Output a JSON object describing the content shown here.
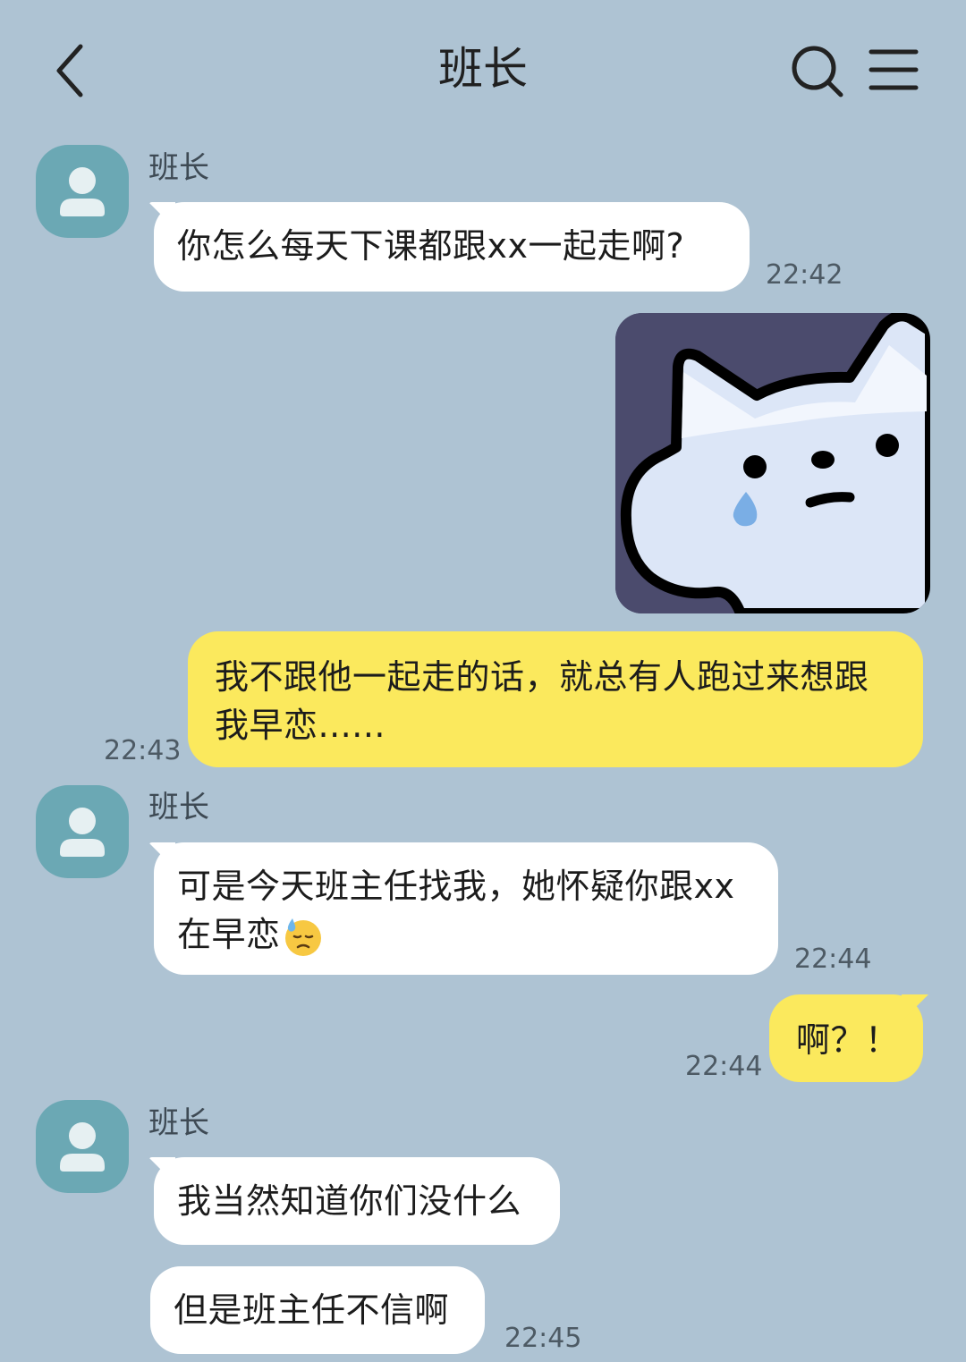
{
  "header": {
    "title": "班长",
    "back_icon": "chevron-left-icon",
    "search_icon": "search-icon",
    "menu_icon": "hamburger-menu-icon"
  },
  "colors": {
    "background": "#aec3d3",
    "incoming_bubble": "#ffffff",
    "outgoing_bubble": "#fbe95d",
    "avatar": "#6ba8b4"
  },
  "messages": [
    {
      "sender": "班长",
      "direction": "incoming",
      "text": "你怎么每天下课都跟xx一起走啊?",
      "time": "22:42"
    },
    {
      "direction": "outgoing",
      "type": "sticker",
      "sticker": "crying-white-cat-sticker"
    },
    {
      "direction": "outgoing",
      "line1": "我不跟他一起走的话，就总有人跑过来想跟",
      "line2": "我早恋......",
      "time": "22:43"
    },
    {
      "sender": "班长",
      "direction": "incoming",
      "line1": "可是今天班主任找我，她怀疑你跟xx",
      "line2": "在早恋",
      "emoji": "downcast-face-with-sweat-emoji",
      "time": "22:44"
    },
    {
      "direction": "outgoing",
      "text": "啊？！",
      "time": "22:44"
    },
    {
      "sender": "班长",
      "direction": "incoming",
      "text": "我当然知道你们没什么"
    },
    {
      "direction": "incoming",
      "text": "但是班主任不信啊",
      "time": "22:45"
    }
  ]
}
